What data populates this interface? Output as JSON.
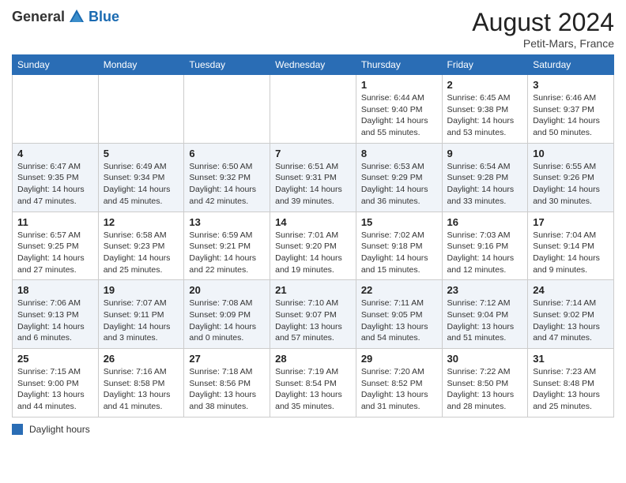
{
  "header": {
    "logo_general": "General",
    "logo_blue": "Blue",
    "month_year": "August 2024",
    "location": "Petit-Mars, France"
  },
  "weekdays": [
    "Sunday",
    "Monday",
    "Tuesday",
    "Wednesday",
    "Thursday",
    "Friday",
    "Saturday"
  ],
  "legend": {
    "label": "Daylight hours"
  },
  "weeks": [
    [
      {
        "day": "",
        "info": ""
      },
      {
        "day": "",
        "info": ""
      },
      {
        "day": "",
        "info": ""
      },
      {
        "day": "",
        "info": ""
      },
      {
        "day": "1",
        "info": "Sunrise: 6:44 AM\nSunset: 9:40 PM\nDaylight: 14 hours\nand 55 minutes."
      },
      {
        "day": "2",
        "info": "Sunrise: 6:45 AM\nSunset: 9:38 PM\nDaylight: 14 hours\nand 53 minutes."
      },
      {
        "day": "3",
        "info": "Sunrise: 6:46 AM\nSunset: 9:37 PM\nDaylight: 14 hours\nand 50 minutes."
      }
    ],
    [
      {
        "day": "4",
        "info": "Sunrise: 6:47 AM\nSunset: 9:35 PM\nDaylight: 14 hours\nand 47 minutes."
      },
      {
        "day": "5",
        "info": "Sunrise: 6:49 AM\nSunset: 9:34 PM\nDaylight: 14 hours\nand 45 minutes."
      },
      {
        "day": "6",
        "info": "Sunrise: 6:50 AM\nSunset: 9:32 PM\nDaylight: 14 hours\nand 42 minutes."
      },
      {
        "day": "7",
        "info": "Sunrise: 6:51 AM\nSunset: 9:31 PM\nDaylight: 14 hours\nand 39 minutes."
      },
      {
        "day": "8",
        "info": "Sunrise: 6:53 AM\nSunset: 9:29 PM\nDaylight: 14 hours\nand 36 minutes."
      },
      {
        "day": "9",
        "info": "Sunrise: 6:54 AM\nSunset: 9:28 PM\nDaylight: 14 hours\nand 33 minutes."
      },
      {
        "day": "10",
        "info": "Sunrise: 6:55 AM\nSunset: 9:26 PM\nDaylight: 14 hours\nand 30 minutes."
      }
    ],
    [
      {
        "day": "11",
        "info": "Sunrise: 6:57 AM\nSunset: 9:25 PM\nDaylight: 14 hours\nand 27 minutes."
      },
      {
        "day": "12",
        "info": "Sunrise: 6:58 AM\nSunset: 9:23 PM\nDaylight: 14 hours\nand 25 minutes."
      },
      {
        "day": "13",
        "info": "Sunrise: 6:59 AM\nSunset: 9:21 PM\nDaylight: 14 hours\nand 22 minutes."
      },
      {
        "day": "14",
        "info": "Sunrise: 7:01 AM\nSunset: 9:20 PM\nDaylight: 14 hours\nand 19 minutes."
      },
      {
        "day": "15",
        "info": "Sunrise: 7:02 AM\nSunset: 9:18 PM\nDaylight: 14 hours\nand 15 minutes."
      },
      {
        "day": "16",
        "info": "Sunrise: 7:03 AM\nSunset: 9:16 PM\nDaylight: 14 hours\nand 12 minutes."
      },
      {
        "day": "17",
        "info": "Sunrise: 7:04 AM\nSunset: 9:14 PM\nDaylight: 14 hours\nand 9 minutes."
      }
    ],
    [
      {
        "day": "18",
        "info": "Sunrise: 7:06 AM\nSunset: 9:13 PM\nDaylight: 14 hours\nand 6 minutes."
      },
      {
        "day": "19",
        "info": "Sunrise: 7:07 AM\nSunset: 9:11 PM\nDaylight: 14 hours\nand 3 minutes."
      },
      {
        "day": "20",
        "info": "Sunrise: 7:08 AM\nSunset: 9:09 PM\nDaylight: 14 hours\nand 0 minutes."
      },
      {
        "day": "21",
        "info": "Sunrise: 7:10 AM\nSunset: 9:07 PM\nDaylight: 13 hours\nand 57 minutes."
      },
      {
        "day": "22",
        "info": "Sunrise: 7:11 AM\nSunset: 9:05 PM\nDaylight: 13 hours\nand 54 minutes."
      },
      {
        "day": "23",
        "info": "Sunrise: 7:12 AM\nSunset: 9:04 PM\nDaylight: 13 hours\nand 51 minutes."
      },
      {
        "day": "24",
        "info": "Sunrise: 7:14 AM\nSunset: 9:02 PM\nDaylight: 13 hours\nand 47 minutes."
      }
    ],
    [
      {
        "day": "25",
        "info": "Sunrise: 7:15 AM\nSunset: 9:00 PM\nDaylight: 13 hours\nand 44 minutes."
      },
      {
        "day": "26",
        "info": "Sunrise: 7:16 AM\nSunset: 8:58 PM\nDaylight: 13 hours\nand 41 minutes."
      },
      {
        "day": "27",
        "info": "Sunrise: 7:18 AM\nSunset: 8:56 PM\nDaylight: 13 hours\nand 38 minutes."
      },
      {
        "day": "28",
        "info": "Sunrise: 7:19 AM\nSunset: 8:54 PM\nDaylight: 13 hours\nand 35 minutes."
      },
      {
        "day": "29",
        "info": "Sunrise: 7:20 AM\nSunset: 8:52 PM\nDaylight: 13 hours\nand 31 minutes."
      },
      {
        "day": "30",
        "info": "Sunrise: 7:22 AM\nSunset: 8:50 PM\nDaylight: 13 hours\nand 28 minutes."
      },
      {
        "day": "31",
        "info": "Sunrise: 7:23 AM\nSunset: 8:48 PM\nDaylight: 13 hours\nand 25 minutes."
      }
    ]
  ]
}
